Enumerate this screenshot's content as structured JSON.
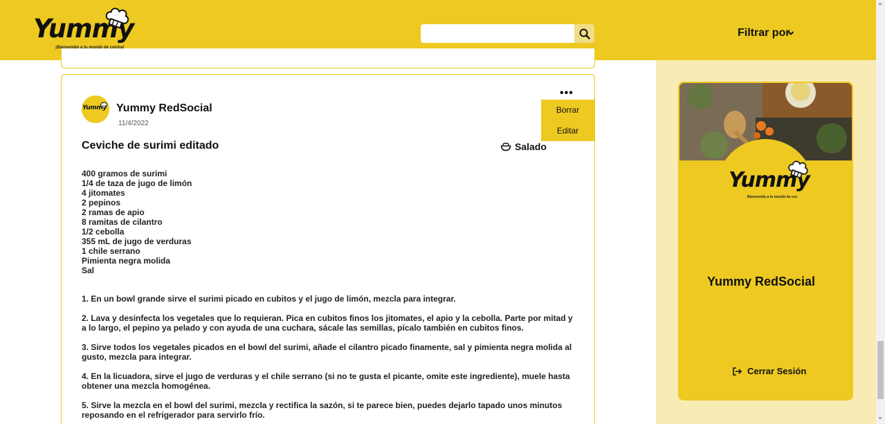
{
  "header": {
    "logo_text": "Yummy",
    "logo_tagline": "¡Bienvenido a tu mundo de cocina!",
    "search_placeholder": "",
    "filter_label": "Filtrar por"
  },
  "post": {
    "author": "Yummy RedSocial",
    "avatar_text": "Yummy",
    "date": "11/4/2022",
    "menu": [
      "Borrar",
      "Editar"
    ],
    "title": "Ceviche de surimi editado",
    "category": "Salado",
    "ingredients": [
      "400 gramos de surimi",
      "1/4 de taza de jugo de limón",
      "4 jitomates",
      "2 pepinos",
      "2 ramas de apio",
      "8 ramitas de cilantro",
      "1/2 cebolla",
      "355 mL de jugo de verduras",
      "1 chile serrano",
      "Pimienta negra molida",
      "Sal"
    ],
    "steps": [
      "1. En un bowl grande sirve el surimi picado en cubitos y el jugo de limón, mezcla para integrar.",
      "2. Lava y desinfecta los vegetales que lo requieran. Pica en cubitos finos los jitomates, el apio y la cebolla. Parte por mitad y a lo largo, el pepino ya pelado y con ayuda de una cuchara, sácale las semillas, pícalo también en cubitos finos.",
      "3. Sirve todos los vegetales picados en el bowl del surimi, añade el cilantro picado finamente, sal y pimienta negra molida al gusto, mezcla para integrar.",
      "4. En la licuadora, sirve el jugo de verduras y el chile serrano (si no te gusta el picante, omite este ingrediente), muele hasta obtener una mezcla homogénea.",
      "5. Sirve la mezcla en el bowl del surimi, mezcla y rectifica la sazón, si te parece bien, puedes dejarlo tapado unos minutos reposando en el refrigerador para servirlo frío."
    ]
  },
  "profile": {
    "logo_text": "Yummy",
    "logo_tagline": "Bienvenido a tu mundo de coc",
    "name": "Yummy RedSocial",
    "logout_label": "Cerrar Sesión"
  },
  "colors": {
    "brand_yellow": "#EDC921",
    "panel_bg": "#F8EBB4"
  }
}
